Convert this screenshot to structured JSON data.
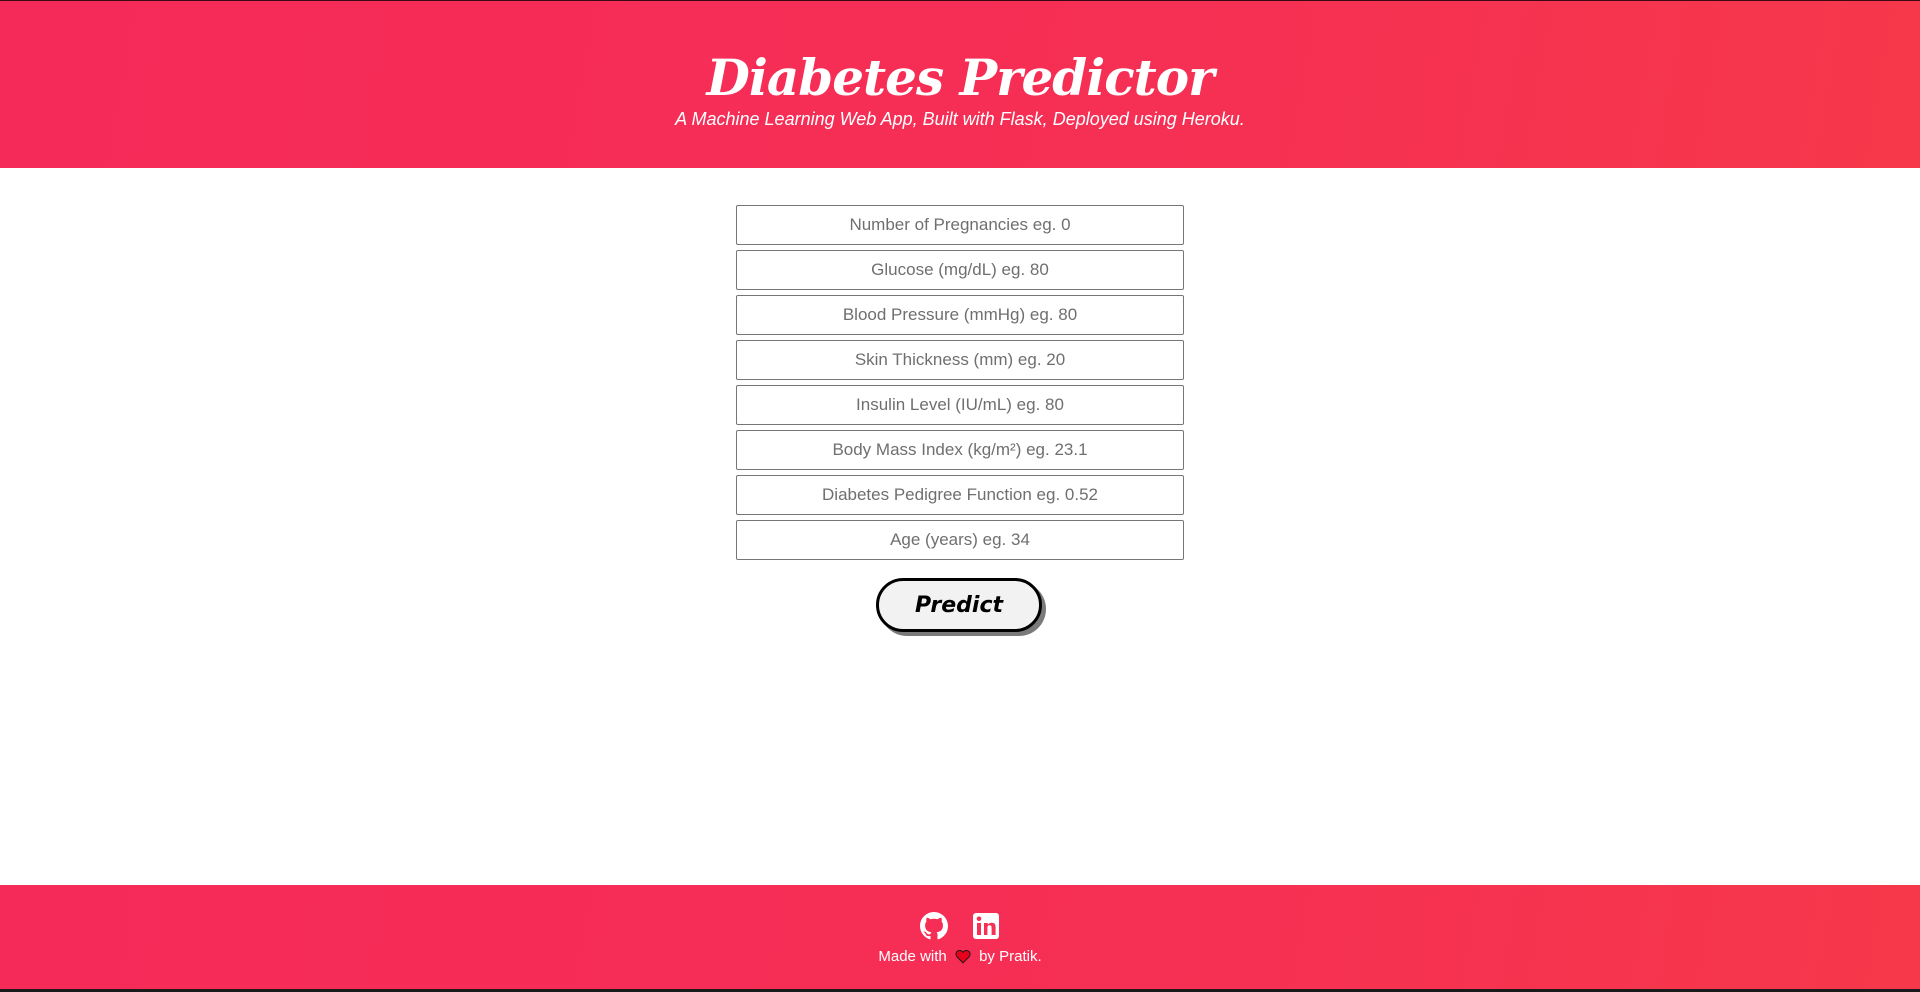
{
  "header": {
    "title": "Diabetes Predictor",
    "subtitle": "A Machine Learning Web App, Built with Flask, Deployed using Heroku."
  },
  "form": {
    "fields": [
      {
        "placeholder": "Number of Pregnancies eg. 0",
        "value": ""
      },
      {
        "placeholder": "Glucose (mg/dL) eg. 80",
        "value": ""
      },
      {
        "placeholder": "Blood Pressure (mmHg) eg. 80",
        "value": ""
      },
      {
        "placeholder": "Skin Thickness (mm) eg. 20",
        "value": ""
      },
      {
        "placeholder": "Insulin Level (IU/mL) eg. 80",
        "value": ""
      },
      {
        "placeholder": "Body Mass Index (kg/m²) eg. 23.1",
        "value": ""
      },
      {
        "placeholder": "Diabetes Pedigree Function eg. 0.52",
        "value": ""
      },
      {
        "placeholder": "Age (years) eg. 34",
        "value": ""
      }
    ],
    "submit_label": "Predict"
  },
  "footer": {
    "links": [
      {
        "icon": "github-icon"
      },
      {
        "icon": "linkedin-icon"
      }
    ],
    "made_with_prefix": "Made with",
    "made_with_suffix": "by Pratik."
  },
  "colors": {
    "brand_gradient_start": "#f62a59",
    "brand_gradient_end": "#f6384a",
    "heart": "#e8001c",
    "button_bg": "#f2f2f2"
  }
}
